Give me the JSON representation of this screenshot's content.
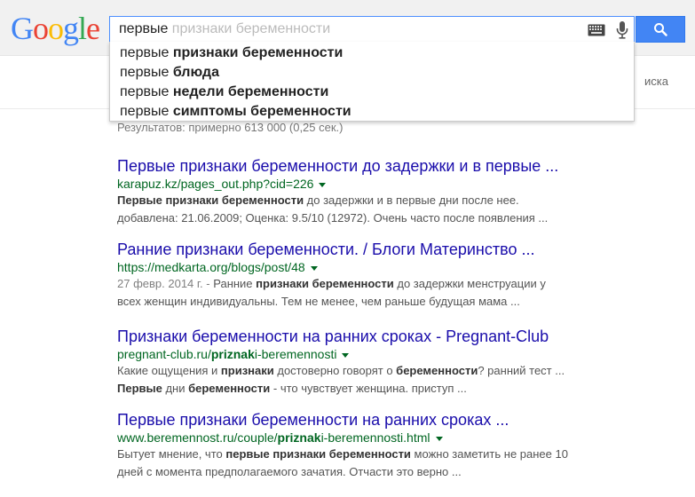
{
  "logo": {
    "letters": [
      "G",
      "o",
      "o",
      "g",
      "l",
      "e"
    ],
    "colors": [
      "#4285f4",
      "#ea4335",
      "#fbbc05",
      "#4285f4",
      "#34a853",
      "#ea4335"
    ]
  },
  "search": {
    "typed": "первые",
    "ghost": " признаки беременности"
  },
  "suggestions": [
    {
      "prefix": "первые ",
      "bold": "признаки беременности"
    },
    {
      "prefix": "первые ",
      "bold": "блюда"
    },
    {
      "prefix": "первые ",
      "bold": "недели беременности"
    },
    {
      "prefix": "первые ",
      "bold": "симптомы беременности"
    }
  ],
  "right_partial": "иска",
  "stats": "Результатов: примерно 613 000 (0,25 сек.)",
  "results": [
    {
      "title": "Первые признаки беременности до задержки и в первые ...",
      "url": [
        {
          "t": "karapuz.kz/pages_out.php?cid=226",
          "b": false
        }
      ],
      "snippet": [
        [
          {
            "t": "Первые признаки беременности",
            "b": true
          },
          {
            "t": " до задержки и в первые дни после нее.",
            "b": false
          }
        ],
        [
          {
            "t": "добавлена: 21.06.2009; Оценка: 9.5/10 (12972). Очень часто после появления ...",
            "b": false
          }
        ]
      ]
    },
    {
      "title": "Ранние признаки беременности. / Блоги Материнство ...",
      "url": [
        {
          "t": "https://medkarta.org/blogs/post/48",
          "b": false
        }
      ],
      "snippet": [
        [
          {
            "t": "27 февр. 2014 г. - ",
            "b": false,
            "date": true
          },
          {
            "t": "Ранние ",
            "b": false
          },
          {
            "t": "признаки беременности",
            "b": true
          },
          {
            "t": " до задержки менструации у",
            "b": false
          }
        ],
        [
          {
            "t": "всех женщин индивидуальны. Тем не менее, чем раньше будущая мама ...",
            "b": false
          }
        ]
      ]
    },
    {
      "title": "Признаки беременности на ранних сроках - Pregnant-Club",
      "url": [
        {
          "t": "pregnant-club.ru/",
          "b": false
        },
        {
          "t": "priznak",
          "b": true
        },
        {
          "t": "i-beremennosti",
          "b": false
        }
      ],
      "snippet": [
        [
          {
            "t": "Какие ощущения и ",
            "b": false
          },
          {
            "t": "признаки",
            "b": true
          },
          {
            "t": " достоверно говорят о ",
            "b": false
          },
          {
            "t": "беременности",
            "b": true
          },
          {
            "t": "? ранний тест ...",
            "b": false
          }
        ],
        [
          {
            "t": "Первые",
            "b": true
          },
          {
            "t": " дни ",
            "b": false
          },
          {
            "t": "беременности",
            "b": true
          },
          {
            "t": " - что чувствует женщина. приступ ...",
            "b": false
          }
        ]
      ]
    },
    {
      "title": "Первые признаки беременности на ранних сроках ...",
      "url": [
        {
          "t": "www.beremennost.ru/couple/",
          "b": false
        },
        {
          "t": "priznak",
          "b": true
        },
        {
          "t": "i-beremennosti.html",
          "b": false
        }
      ],
      "snippet": [
        [
          {
            "t": "Бытует мнение, что ",
            "b": false
          },
          {
            "t": "первые признаки беременности",
            "b": true
          },
          {
            "t": " можно заметить не ранее 10",
            "b": false
          }
        ],
        [
          {
            "t": "дней с момента предполагаемого зачатия. Отчасти это верно ...",
            "b": false
          }
        ]
      ]
    }
  ]
}
